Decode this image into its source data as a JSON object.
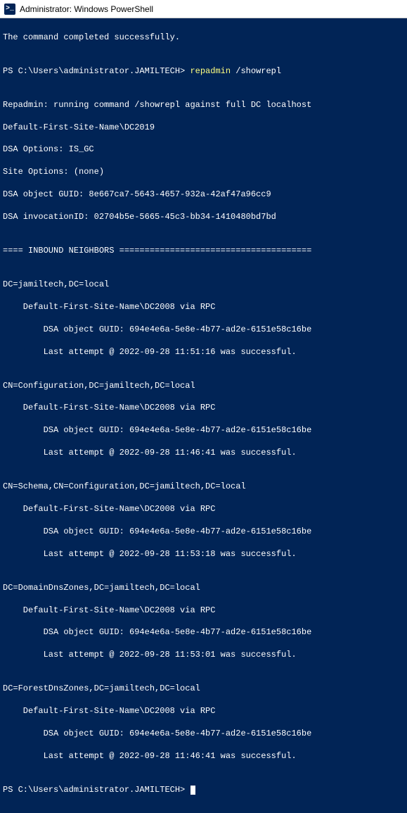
{
  "titlebar": {
    "icon_label": ">_",
    "title": "Administrator: Windows PowerShell"
  },
  "term": {
    "l1": "The command completed successfully.",
    "blank": "",
    "prompt1_path": "PS C:\\Users\\administrator.JAMILTECH> ",
    "prompt1_cmd_a": "repadmin",
    "prompt1_cmd_b": " /showrepl",
    "r1": "Repadmin: running command /showrepl against full DC localhost",
    "r2": "Default-First-Site-Name\\DC2019",
    "r3": "DSA Options: IS_GC",
    "r4": "Site Options: (none)",
    "r5": "DSA object GUID: 8e667ca7-5643-4657-932a-42af47a96cc9",
    "r6": "DSA invocationID: 02704b5e-5665-45c3-bb34-1410480bd7bd",
    "hdr": "==== INBOUND NEIGHBORS ======================================",
    "b1a": "DC=jamiltech,DC=local",
    "b1b": "    Default-First-Site-Name\\DC2008 via RPC",
    "b1c": "        DSA object GUID: 694e4e6a-5e8e-4b77-ad2e-6151e58c16be",
    "b1d": "        Last attempt @ 2022-09-28 11:51:16 was successful.",
    "b2a": "CN=Configuration,DC=jamiltech,DC=local",
    "b2b": "    Default-First-Site-Name\\DC2008 via RPC",
    "b2c": "        DSA object GUID: 694e4e6a-5e8e-4b77-ad2e-6151e58c16be",
    "b2d": "        Last attempt @ 2022-09-28 11:46:41 was successful.",
    "b3a": "CN=Schema,CN=Configuration,DC=jamiltech,DC=local",
    "b3b": "    Default-First-Site-Name\\DC2008 via RPC",
    "b3c": "        DSA object GUID: 694e4e6a-5e8e-4b77-ad2e-6151e58c16be",
    "b3d": "        Last attempt @ 2022-09-28 11:53:18 was successful.",
    "b4a": "DC=DomainDnsZones,DC=jamiltech,DC=local",
    "b4b": "    Default-First-Site-Name\\DC2008 via RPC",
    "b4c": "        DSA object GUID: 694e4e6a-5e8e-4b77-ad2e-6151e58c16be",
    "b4d": "        Last attempt @ 2022-09-28 11:53:01 was successful.",
    "b5a": "DC=ForestDnsZones,DC=jamiltech,DC=local",
    "b5b": "    Default-First-Site-Name\\DC2008 via RPC",
    "b5c": "        DSA object GUID: 694e4e6a-5e8e-4b77-ad2e-6151e58c16be",
    "b5d": "        Last attempt @ 2022-09-28 11:46:41 was successful.",
    "prompt2": "PS C:\\Users\\administrator.JAMILTECH> "
  }
}
